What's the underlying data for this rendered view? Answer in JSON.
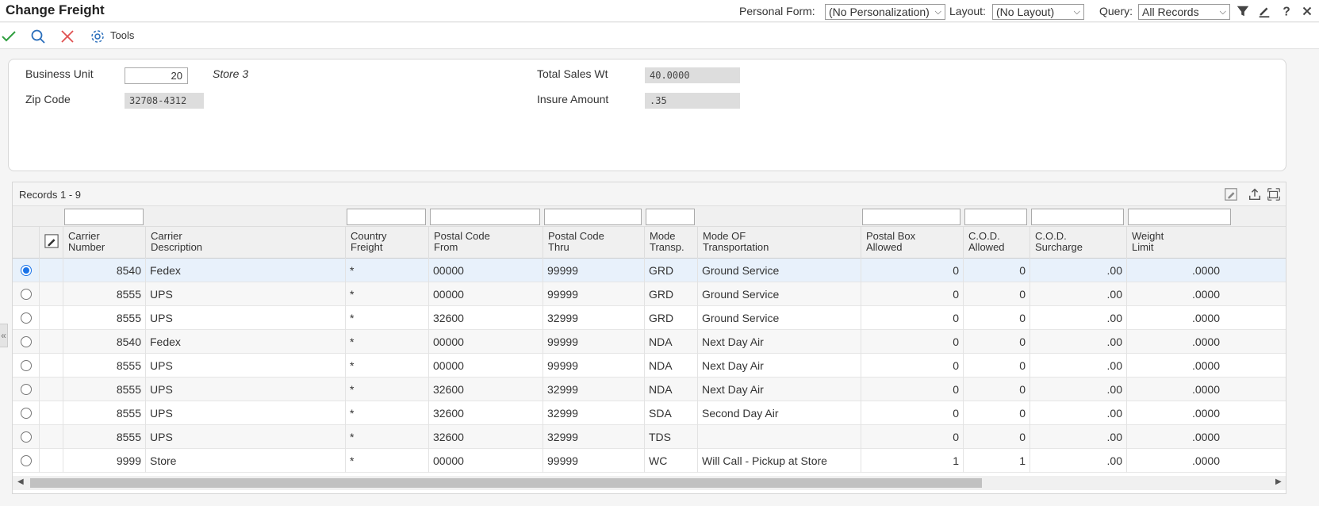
{
  "window": {
    "title": "Change Freight",
    "personal_form_label": "Personal Form:",
    "personal_form_value": "(No Personalization)",
    "layout_label": "Layout:",
    "layout_value": "(No Layout)",
    "query_label": "Query:",
    "query_value": "All Records",
    "icons": [
      "filter-icon",
      "edit-icon",
      "help-icon",
      "close-icon"
    ]
  },
  "toolbar": {
    "tools_label": "Tools",
    "icons": [
      "ok-check-icon",
      "find-search-icon",
      "cancel-x-icon",
      "gear-icon"
    ]
  },
  "form": {
    "business_unit_label": "Business Unit",
    "business_unit_value": "20",
    "business_unit_desc": "Store 3",
    "zip_code_label": "Zip Code",
    "zip_code_value": "32708-4312",
    "total_sales_wt_label": "Total Sales Wt",
    "total_sales_wt_value": "40.0000",
    "insure_amount_label": "Insure Amount",
    "insure_amount_value": ".35"
  },
  "grid": {
    "records_label": "Records 1 - 9",
    "columns": [
      {
        "key": "carrier_number",
        "label": "Carrier\nNumber"
      },
      {
        "key": "carrier_description",
        "label": "Carrier\nDescription"
      },
      {
        "key": "country_freight",
        "label": "Country\nFreight"
      },
      {
        "key": "postal_code_from",
        "label": "Postal Code\nFrom"
      },
      {
        "key": "postal_code_thru",
        "label": "Postal Code\nThru"
      },
      {
        "key": "mode_transp",
        "label": "Mode\nTransp."
      },
      {
        "key": "mode_of_transportation",
        "label": "Mode OF\nTransportation"
      },
      {
        "key": "postal_box_allowed",
        "label": "Postal Box\nAllowed"
      },
      {
        "key": "cod_allowed",
        "label": "C.O.D.\nAllowed"
      },
      {
        "key": "cod_surcharge",
        "label": "C.O.D.\nSurcharge"
      },
      {
        "key": "weight_limit",
        "label": "Weight\nLimit"
      }
    ],
    "rows": [
      {
        "carrier_number": "8540",
        "carrier_description": "Fedex",
        "country_freight": "*",
        "postal_code_from": "00000",
        "postal_code_thru": "99999",
        "mode_transp": "GRD",
        "mode_of_transportation": "Ground Service",
        "postal_box_allowed": "0",
        "cod_allowed": "0",
        "cod_surcharge": ".00",
        "weight_limit": ".0000",
        "selected": true
      },
      {
        "carrier_number": "8555",
        "carrier_description": "UPS",
        "country_freight": "*",
        "postal_code_from": "00000",
        "postal_code_thru": "99999",
        "mode_transp": "GRD",
        "mode_of_transportation": "Ground Service",
        "postal_box_allowed": "0",
        "cod_allowed": "0",
        "cod_surcharge": ".00",
        "weight_limit": ".0000",
        "selected": false
      },
      {
        "carrier_number": "8555",
        "carrier_description": "UPS",
        "country_freight": "*",
        "postal_code_from": "32600",
        "postal_code_thru": "32999",
        "mode_transp": "GRD",
        "mode_of_transportation": "Ground Service",
        "postal_box_allowed": "0",
        "cod_allowed": "0",
        "cod_surcharge": ".00",
        "weight_limit": ".0000",
        "selected": false
      },
      {
        "carrier_number": "8540",
        "carrier_description": "Fedex",
        "country_freight": "*",
        "postal_code_from": "00000",
        "postal_code_thru": "99999",
        "mode_transp": "NDA",
        "mode_of_transportation": "Next Day Air",
        "postal_box_allowed": "0",
        "cod_allowed": "0",
        "cod_surcharge": ".00",
        "weight_limit": ".0000",
        "selected": false
      },
      {
        "carrier_number": "8555",
        "carrier_description": "UPS",
        "country_freight": "*",
        "postal_code_from": "00000",
        "postal_code_thru": "99999",
        "mode_transp": "NDA",
        "mode_of_transportation": "Next Day Air",
        "postal_box_allowed": "0",
        "cod_allowed": "0",
        "cod_surcharge": ".00",
        "weight_limit": ".0000",
        "selected": false
      },
      {
        "carrier_number": "8555",
        "carrier_description": "UPS",
        "country_freight": "*",
        "postal_code_from": "32600",
        "postal_code_thru": "32999",
        "mode_transp": "NDA",
        "mode_of_transportation": "Next Day Air",
        "postal_box_allowed": "0",
        "cod_allowed": "0",
        "cod_surcharge": ".00",
        "weight_limit": ".0000",
        "selected": false
      },
      {
        "carrier_number": "8555",
        "carrier_description": "UPS",
        "country_freight": "*",
        "postal_code_from": "32600",
        "postal_code_thru": "32999",
        "mode_transp": "SDA",
        "mode_of_transportation": "Second Day Air",
        "postal_box_allowed": "0",
        "cod_allowed": "0",
        "cod_surcharge": ".00",
        "weight_limit": ".0000",
        "selected": false
      },
      {
        "carrier_number": "8555",
        "carrier_description": "UPS",
        "country_freight": "*",
        "postal_code_from": "32600",
        "postal_code_thru": "32999",
        "mode_transp": "TDS",
        "mode_of_transportation": "",
        "postal_box_allowed": "0",
        "cod_allowed": "0",
        "cod_surcharge": ".00",
        "weight_limit": ".0000",
        "selected": false
      },
      {
        "carrier_number": "9999",
        "carrier_description": "Store",
        "country_freight": "*",
        "postal_code_from": "00000",
        "postal_code_thru": "99999",
        "mode_transp": "WC",
        "mode_of_transportation": "Will Call - Pickup at Store",
        "postal_box_allowed": "1",
        "cod_allowed": "1",
        "cod_surcharge": ".00",
        "weight_limit": ".0000",
        "selected": false
      }
    ]
  }
}
